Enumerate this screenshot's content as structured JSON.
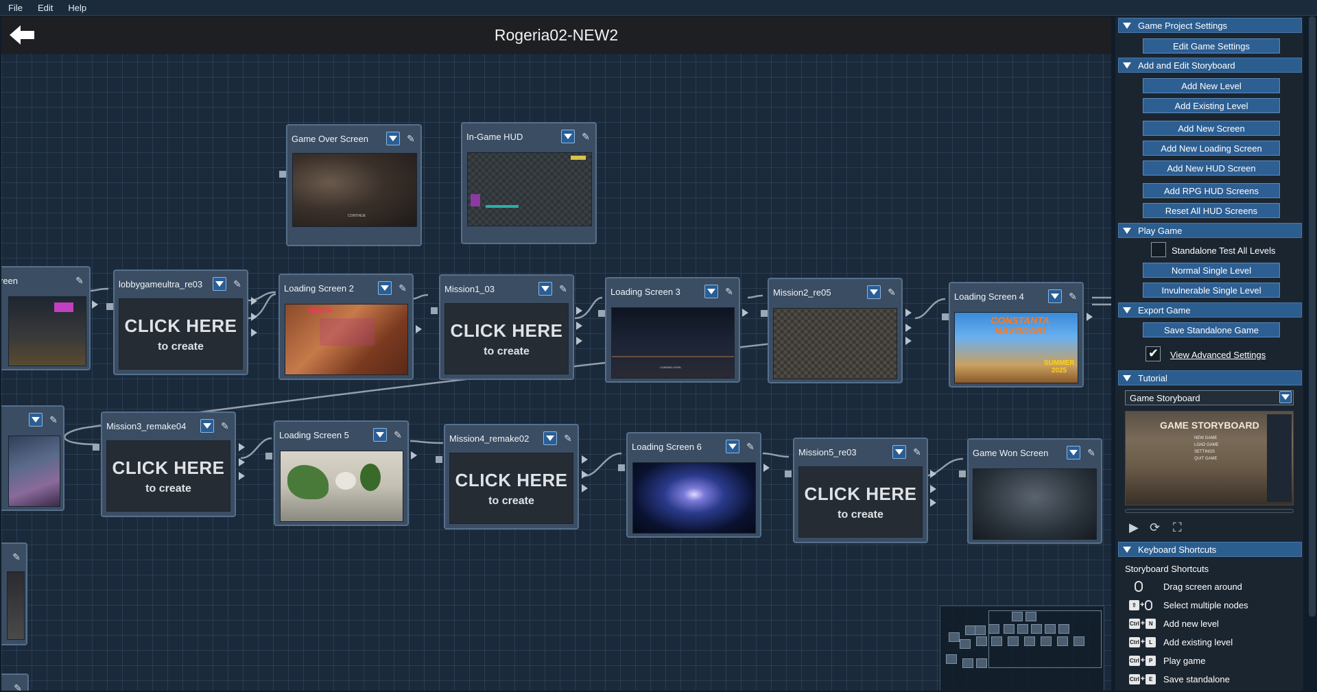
{
  "menu": [
    "File",
    "Edit",
    "Help"
  ],
  "window_title": "Rogeria02-NEW2",
  "icons": {
    "back": "back-arrow-icon",
    "dropdown": "dropdown-arrow-icon",
    "edit": "pencil-icon"
  },
  "nodes": {
    "game_over": {
      "title": "Game Over Screen"
    },
    "hud": {
      "title": "In-Game HUD"
    },
    "screen_partial": {
      "title": "reen"
    },
    "lobby": {
      "title": "lobbygameultra_re03"
    },
    "loading2": {
      "title": "Loading Screen 2"
    },
    "mission1": {
      "title": "Mission1_03"
    },
    "loading3": {
      "title": "Loading Screen 3"
    },
    "mission2": {
      "title": "Mission2_re05"
    },
    "loading4": {
      "title": "Loading Screen 4"
    },
    "mission3": {
      "title": "Mission3_remake04"
    },
    "loading5": {
      "title": "Loading Screen 5"
    },
    "mission4": {
      "title": "Mission4_remake02"
    },
    "loading6": {
      "title": "Loading Screen 6"
    },
    "mission5": {
      "title": "Mission5_re03"
    },
    "game_won": {
      "title": "Game Won Screen"
    }
  },
  "click_here": {
    "big": "CLICK HERE",
    "small": "to create"
  },
  "thumb_text": {
    "loading2_brand": "TENUTA",
    "loading4_title": "CONSTANTA NAVODARI",
    "loading4_badge": "SUMMER 2025",
    "loading_levels": "LOADING LEVEL",
    "continue": "CONTINUE"
  },
  "panel": {
    "game_project_settings": "Game Project Settings",
    "edit_game_settings": "Edit Game Settings",
    "add_edit_storyboard": "Add and Edit Storyboard",
    "add_new_level": "Add New Level",
    "add_existing_level": "Add Existing Level",
    "add_new_screen": "Add New Screen",
    "add_new_loading_screen": "Add New Loading Screen",
    "add_new_hud_screen": "Add New HUD Screen",
    "add_rpg_hud_screens": "Add RPG HUD Screens",
    "reset_all_hud_screens": "Reset All HUD Screens",
    "play_game": "Play Game",
    "standalone_test": "Standalone Test All Levels",
    "normal_single_level": "Normal Single Level",
    "invulnerable_single_level": "Invulnerable Single Level",
    "export_game": "Export Game",
    "save_standalone_game": "Save Standalone Game",
    "view_advanced_settings": "View Advanced Settings",
    "tutorial": "Tutorial",
    "tutorial_select": "Game Storyboard",
    "video_title": "GAME STORYBOARD",
    "video_menu": [
      "NEW GAME",
      "LOAD GAME",
      "SETTINGS",
      "QUIT GAME"
    ],
    "keyboard_shortcuts": "Keyboard Shortcuts",
    "storyboard_shortcuts": "Storyboard Shortcuts"
  },
  "checkboxes": {
    "standalone_test": false,
    "view_advanced_settings": true
  },
  "shortcuts": [
    {
      "keys": [
        "mouse"
      ],
      "label": "Drag screen around"
    },
    {
      "keys": [
        "⇧",
        "mouse"
      ],
      "label": "Select multiple nodes"
    },
    {
      "keys": [
        "Ctrl",
        "N"
      ],
      "label": "Add new level"
    },
    {
      "keys": [
        "Ctrl",
        "L"
      ],
      "label": "Add existing level"
    },
    {
      "keys": [
        "Ctrl",
        "P"
      ],
      "label": "Play game"
    },
    {
      "keys": [
        "Ctrl",
        "E"
      ],
      "label": "Save standalone"
    }
  ]
}
